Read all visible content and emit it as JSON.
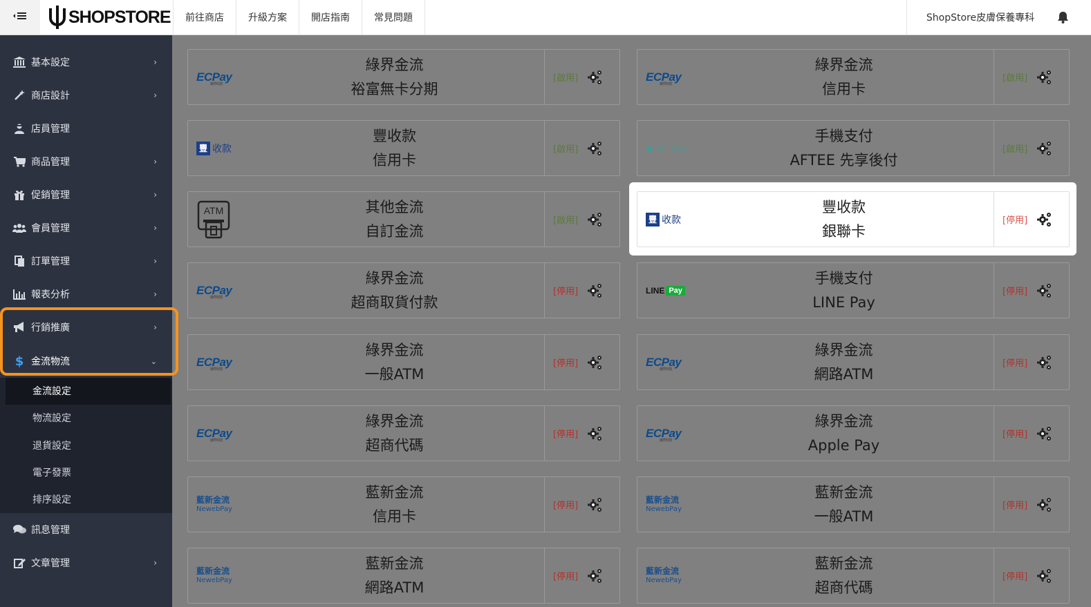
{
  "topbar": {
    "toggle_icon": "menu-collapse-icon",
    "logo_text": "SHOPSTORE",
    "nav": [
      "前往商店",
      "升級方案",
      "開店指南",
      "常見問題"
    ],
    "store_name": "ShopStore皮膚保養專科",
    "bell_icon": "bell-icon"
  },
  "sidebar": {
    "items": [
      {
        "label": "基本設定",
        "icon": "bank-icon",
        "chevron": true
      },
      {
        "label": "商店設計",
        "icon": "magic-wand-icon",
        "chevron": true
      },
      {
        "label": "店員管理",
        "icon": "user-secret-icon",
        "chevron": false
      },
      {
        "label": "商品管理",
        "icon": "cart-icon",
        "chevron": true
      },
      {
        "label": "促銷管理",
        "icon": "gift-icon",
        "chevron": true
      },
      {
        "label": "會員管理",
        "icon": "users-icon",
        "chevron": true
      },
      {
        "label": "訂單管理",
        "icon": "copy-icon",
        "chevron": true
      },
      {
        "label": "報表分析",
        "icon": "bar-chart-icon",
        "chevron": true
      },
      {
        "label": "行銷推廣",
        "icon": "bullhorn-icon",
        "chevron": true
      },
      {
        "label": "金流物流",
        "icon": "dollar-icon",
        "chevron": "down"
      },
      {
        "label": "訊息管理",
        "icon": "comments-icon",
        "chevron": false
      },
      {
        "label": "文章管理",
        "icon": "edit-icon",
        "chevron": true
      }
    ],
    "subitems": [
      "金流設定",
      "物流設定",
      "退貨設定",
      "電子發票",
      "排序設定"
    ]
  },
  "status_labels": {
    "enabled": "[啟用]",
    "disabled": "[停用]"
  },
  "cards": [
    {
      "logo": "ecpay",
      "line1": "綠界金流",
      "line2": "裕富無卡分期",
      "status": "[啟用]"
    },
    {
      "logo": "ecpay",
      "line1": "綠界金流",
      "line2": "信用卡",
      "status": "[啟用]"
    },
    {
      "logo": "fng",
      "line1": "豐收款",
      "line2": "信用卡",
      "status": "[啟用]"
    },
    {
      "logo": "aftee",
      "line1": "手機支付",
      "line2": "AFTEE 先享後付",
      "status": "[啟用]"
    },
    {
      "logo": "atm",
      "line1": "其他金流",
      "line2": "自訂金流",
      "status": "[啟用]"
    },
    {
      "logo": "fng",
      "line1": "豐收款",
      "line2": "銀聯卡",
      "status": "[停用]"
    },
    {
      "logo": "ecpay",
      "line1": "綠界金流",
      "line2": "超商取貨付款",
      "status": "[停用]"
    },
    {
      "logo": "linepay",
      "line1": "手機支付",
      "line2": "LINE Pay",
      "status": "[停用]"
    },
    {
      "logo": "ecpay",
      "line1": "綠界金流",
      "line2": "一般ATM",
      "status": "[停用]"
    },
    {
      "logo": "ecpay",
      "line1": "綠界金流",
      "line2": "網路ATM",
      "status": "[停用]"
    },
    {
      "logo": "ecpay",
      "line1": "綠界金流",
      "line2": "超商代碼",
      "status": "[停用]"
    },
    {
      "logo": "ecpay",
      "line1": "綠界金流",
      "line2": "Apple Pay",
      "status": "[停用]"
    },
    {
      "logo": "newebpay",
      "line1": "藍新金流",
      "line2": "信用卡",
      "status": "[停用]"
    },
    {
      "logo": "newebpay",
      "line1": "藍新金流",
      "line2": "一般ATM",
      "status": "[停用]"
    },
    {
      "logo": "newebpay",
      "line1": "藍新金流",
      "line2": "網路ATM",
      "status": "[停用]"
    },
    {
      "logo": "newebpay",
      "line1": "藍新金流",
      "line2": "超商代碼",
      "status": "[停用]"
    }
  ],
  "logos": {
    "ecpay_text": "ECPay",
    "ecpay_sub": "綠界科技",
    "fng_box": "豐",
    "fng_text": "收款",
    "newebpay_l1": "藍新金流",
    "newebpay_l2": "NewebPay",
    "aftee_text": "AFTEE",
    "linepay_line": "LINE",
    "linepay_pay": "Pay",
    "atm_text": "ATM"
  },
  "colors": {
    "accent_highlight": "#f7931e",
    "enabled": "#5a7a3a",
    "disabled": "#b4302a",
    "sidebar_bg": "#2d3240"
  }
}
